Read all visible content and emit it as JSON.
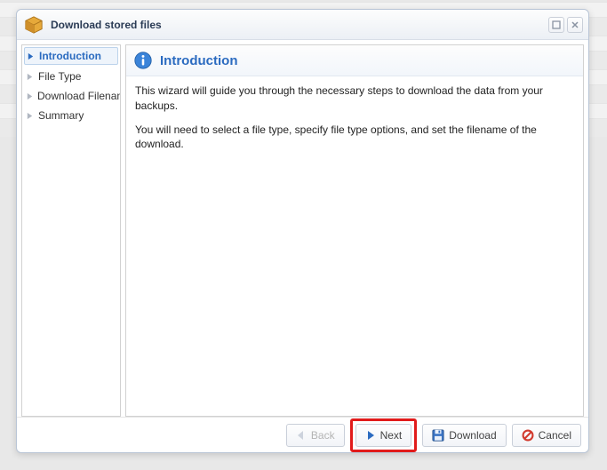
{
  "dialog": {
    "title": "Download stored files"
  },
  "sidebar": {
    "steps": [
      {
        "label": "Introduction",
        "active": true
      },
      {
        "label": "File Type",
        "active": false
      },
      {
        "label": "Download Filename",
        "active": false
      },
      {
        "label": "Summary",
        "active": false
      }
    ]
  },
  "content": {
    "heading": "Introduction",
    "para1": "This wizard will guide you through the necessary steps to download the data from your backups.",
    "para2": "You will need to select a file type, specify file type options, and set the filename of the download."
  },
  "footer": {
    "back": "Back",
    "next": "Next",
    "download": "Download",
    "cancel": "Cancel"
  }
}
